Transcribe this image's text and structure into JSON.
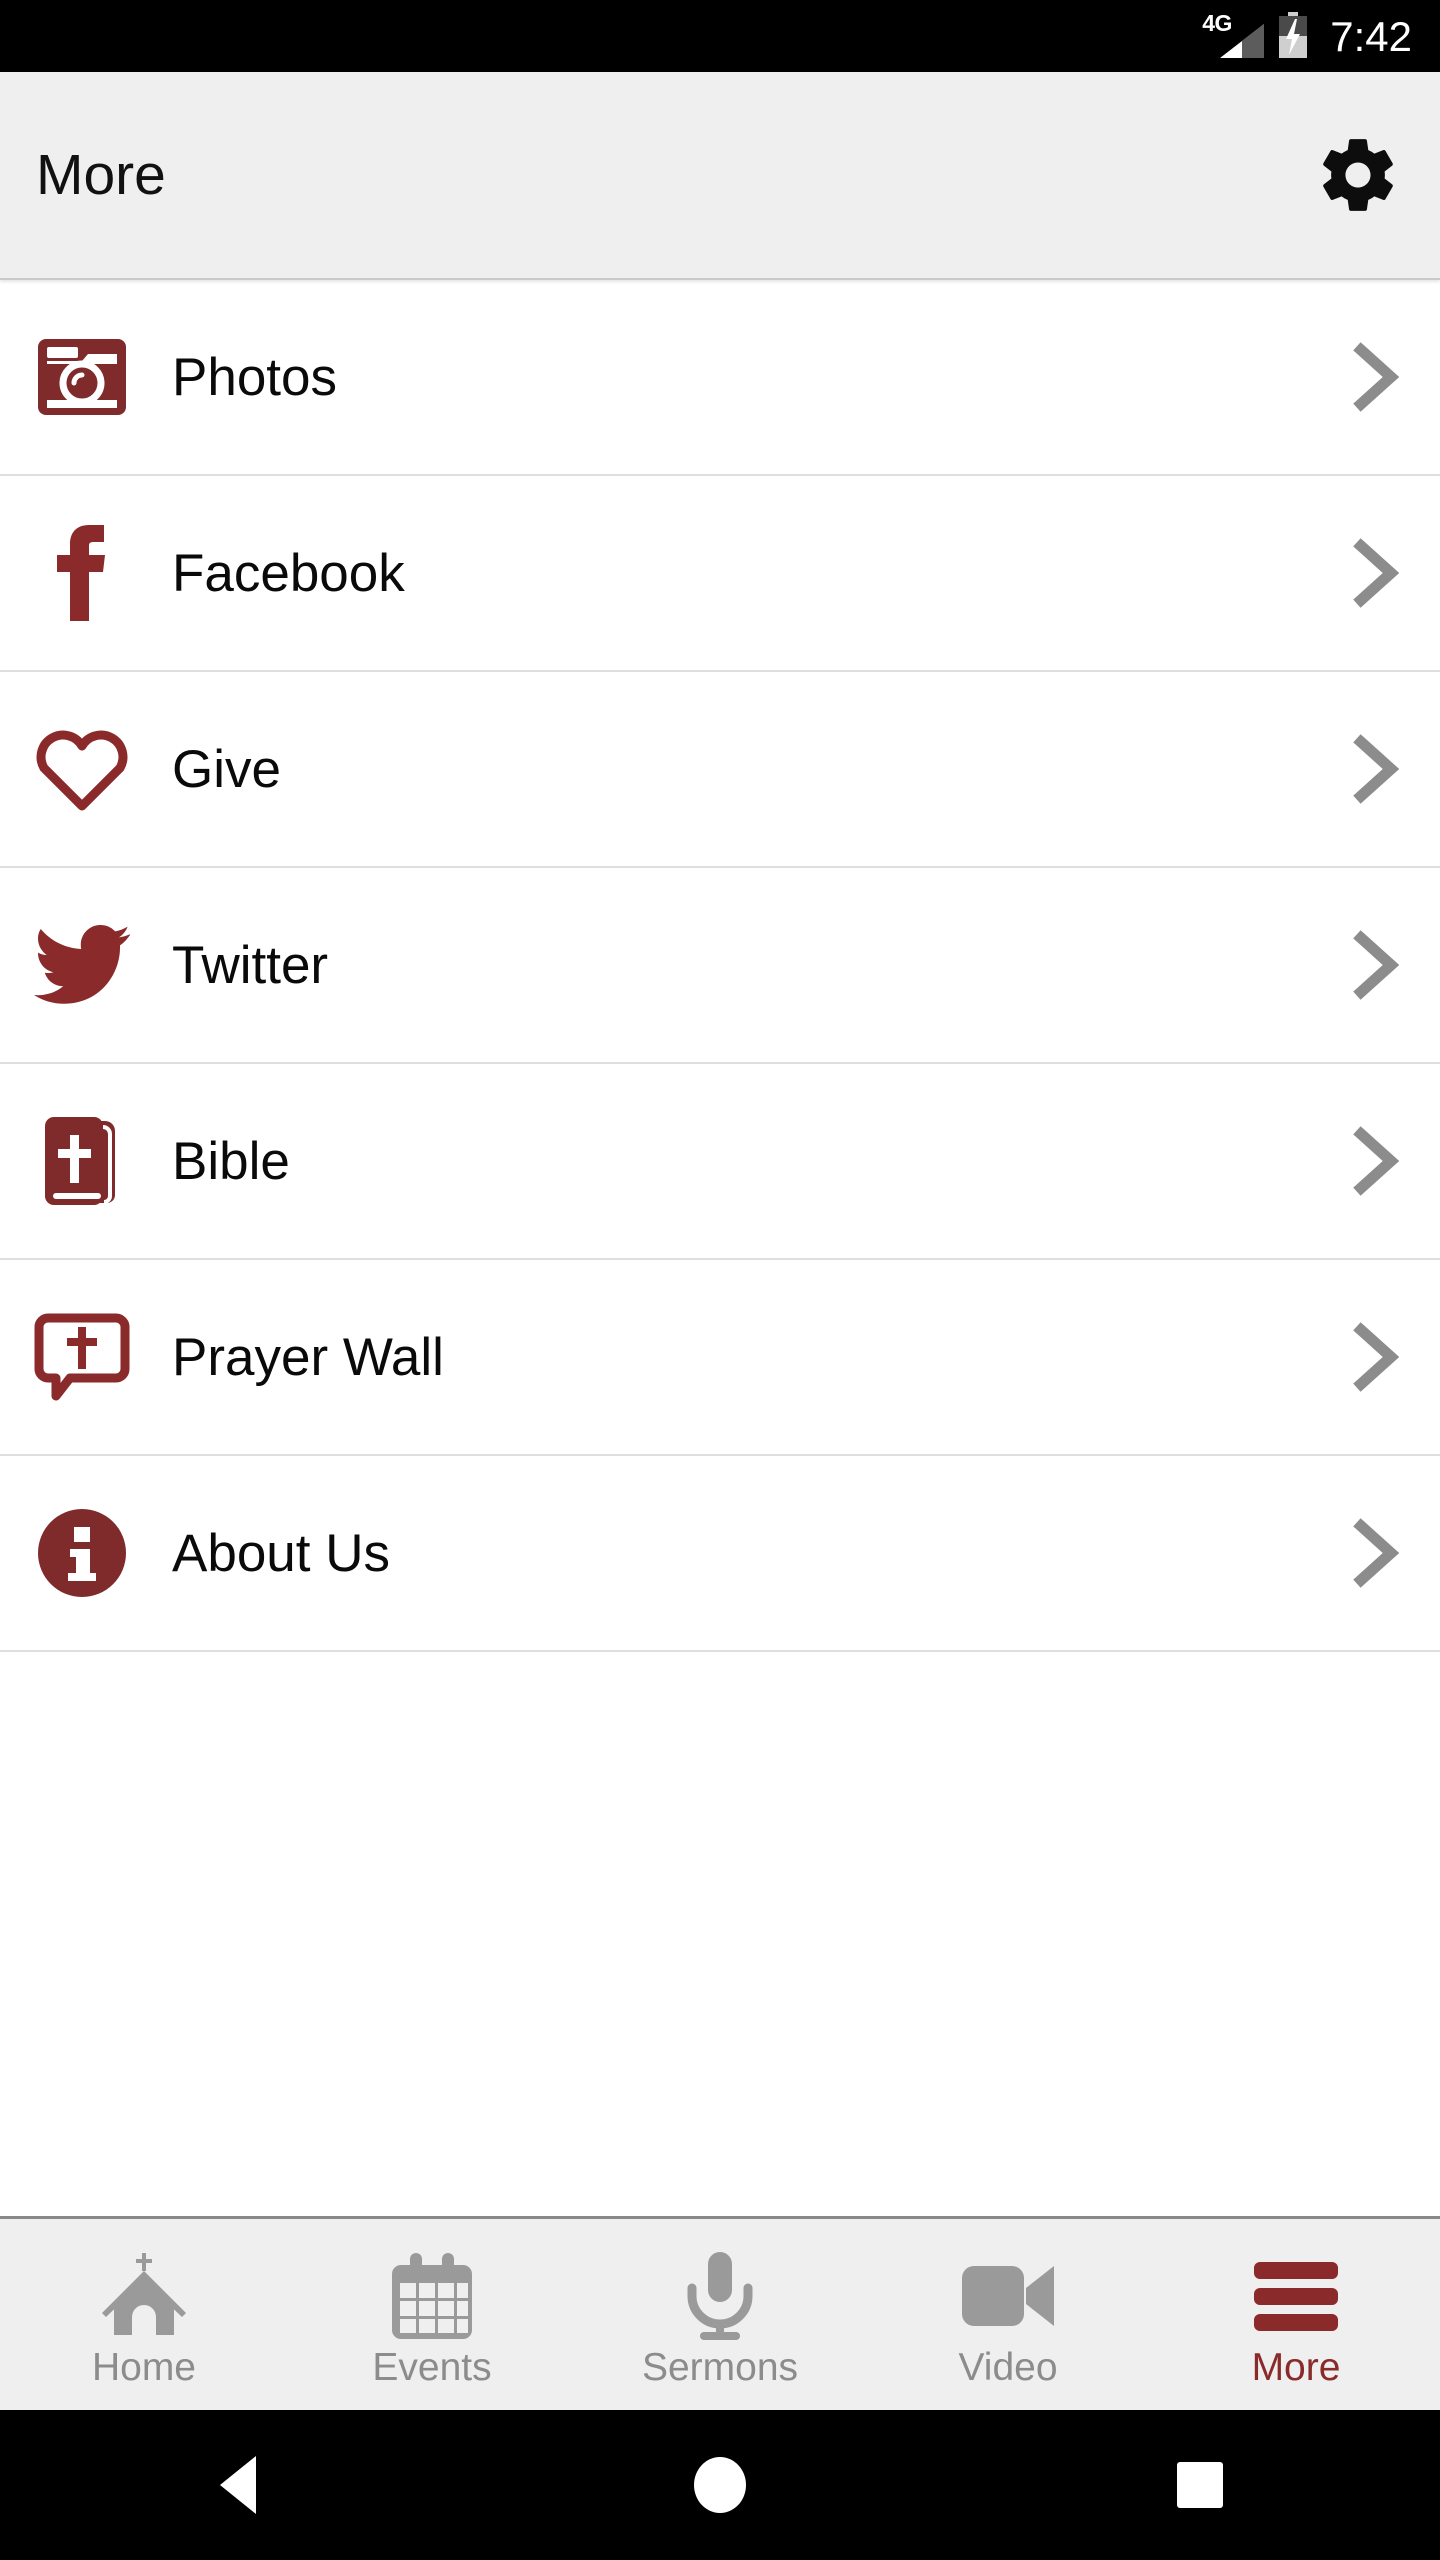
{
  "status_bar": {
    "network_label": "4G",
    "signal_icon": "signal-triangle-icon",
    "battery_icon": "battery-charging-icon",
    "time": "7:42"
  },
  "header": {
    "title": "More",
    "settings_icon": "gear-icon"
  },
  "colors": {
    "brand_maroon": "#8a2a2a",
    "icon_maroon": "#7f2b2b",
    "header_bg": "#efefef",
    "divider": "#dedede",
    "chevron_gray": "#8c8c8c",
    "tab_inactive": "#9a9a9a",
    "text": "#0a0a0a"
  },
  "list": {
    "items": [
      {
        "label": "Photos",
        "icon": "camera-icon",
        "chevron": "chevron-right-icon"
      },
      {
        "label": "Facebook",
        "icon": "facebook-icon",
        "chevron": "chevron-right-icon"
      },
      {
        "label": "Give",
        "icon": "heart-outline-icon",
        "chevron": "chevron-right-icon"
      },
      {
        "label": "Twitter",
        "icon": "twitter-bird-icon",
        "chevron": "chevron-right-icon"
      },
      {
        "label": "Bible",
        "icon": "bible-book-icon",
        "chevron": "chevron-right-icon"
      },
      {
        "label": "Prayer Wall",
        "icon": "prayer-bubble-icon",
        "chevron": "chevron-right-icon"
      },
      {
        "label": "About Us",
        "icon": "info-circle-icon",
        "chevron": "chevron-right-icon"
      }
    ]
  },
  "tabbar": {
    "tabs": [
      {
        "label": "Home",
        "icon": "church-icon",
        "active": false
      },
      {
        "label": "Events",
        "icon": "calendar-icon",
        "active": false
      },
      {
        "label": "Sermons",
        "icon": "microphone-icon",
        "active": false
      },
      {
        "label": "Video",
        "icon": "camcorder-icon",
        "active": false
      },
      {
        "label": "More",
        "icon": "hamburger-icon",
        "active": true
      }
    ]
  },
  "android_nav": {
    "back_icon": "triangle-back-icon",
    "home_icon": "circle-home-icon",
    "recents_icon": "square-recents-icon"
  }
}
